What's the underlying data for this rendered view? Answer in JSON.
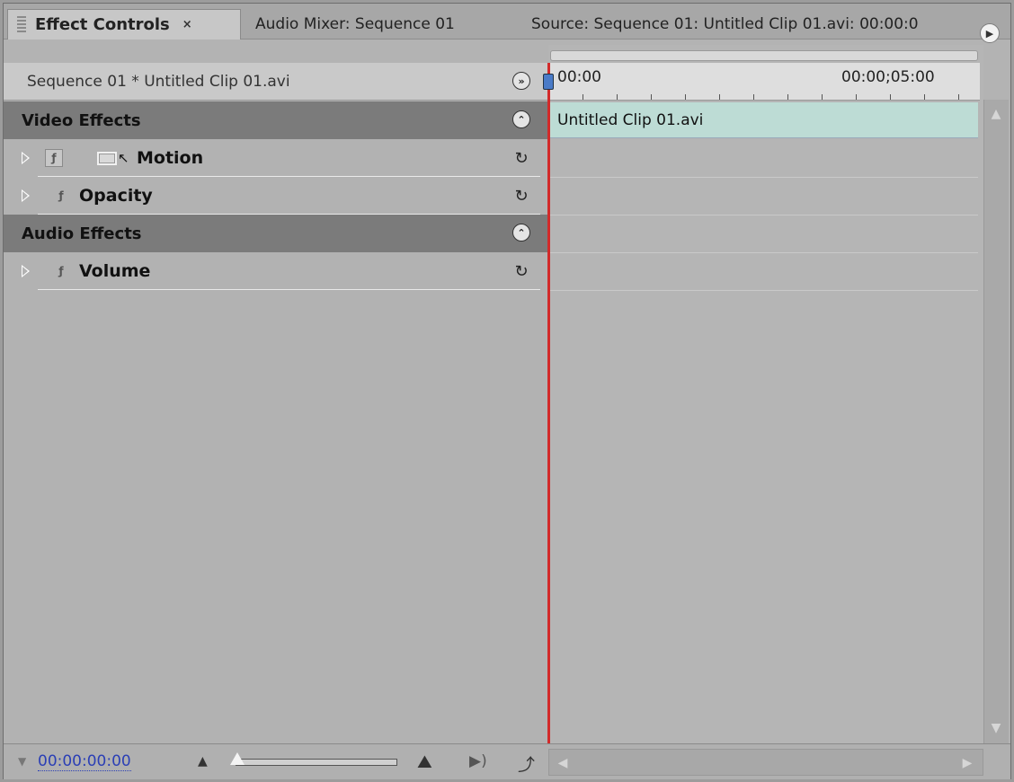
{
  "tabs": [
    {
      "label": "Effect Controls",
      "close": "×"
    },
    {
      "label": "Audio Mixer: Sequence 01"
    },
    {
      "label": "Source: Sequence 01: Untitled Clip 01.avi: 00:00:0"
    }
  ],
  "sequence_label": "Sequence 01 * Untitled Clip 01.avi",
  "sections": {
    "video": "Video Effects",
    "audio": "Audio Effects"
  },
  "effects": {
    "motion": "Motion",
    "opacity": "Opacity",
    "volume": "Volume"
  },
  "ruler": {
    "start": "00:00",
    "mark": "00:00;05:00"
  },
  "clip_name": "Untitled Clip 01.avi",
  "current_time": "00:00:00:00",
  "colors": {
    "playhead": "#d22a2a",
    "clip_bar": "#bddcd5",
    "timecode": "#2b3fb5"
  }
}
